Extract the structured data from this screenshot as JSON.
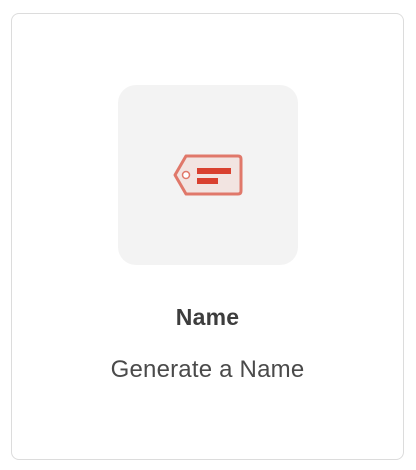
{
  "card": {
    "title": "Name",
    "subtitle": "Generate a Name",
    "icon": "name-tag-icon",
    "colors": {
      "tile_background": "#f3f3f3",
      "tag_fill": "#f2e4e1",
      "tag_stroke": "#e0786a",
      "tag_bars": "#d9402f",
      "border": "#dcdcdc"
    }
  }
}
